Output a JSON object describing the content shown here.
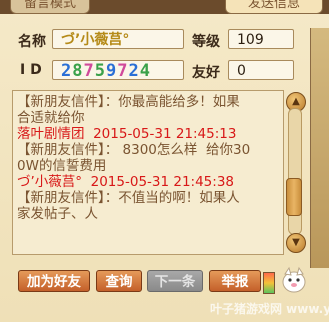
{
  "tabs": {
    "left": "留言模式",
    "right": "发送信息"
  },
  "info": {
    "name_label": "名称",
    "name_value": "づ’小薇莒°",
    "level_label": "等级",
    "level_value": "109",
    "id_label": "I D",
    "id_value": [
      "2",
      "8",
      "7",
      "5",
      "9",
      "7",
      "2",
      "4"
    ],
    "friend_label": "友好",
    "friend_value": "0"
  },
  "messages": [
    {
      "type": "sys",
      "text": "【新朋友信件】：你最高能给多！如果"
    },
    {
      "type": "sys",
      "text": "合适就给你"
    },
    {
      "type": "red",
      "text": "落叶剧情团  2015-05-31 21:45:13"
    },
    {
      "type": "sys",
      "text": "【新朋友信件】： 8300怎么样  给你30"
    },
    {
      "type": "sys",
      "text": "0W的信誓费用"
    },
    {
      "type": "red",
      "text": "づ’小薇莒°  2015-05-31 21:45:38"
    },
    {
      "type": "sys",
      "text": "【新朋友信件】：不值当的啊！如果人"
    },
    {
      "type": "sys",
      "text": "家发帖子、人"
    }
  ],
  "buttons": {
    "add_friend": "加为好友",
    "query": "查询",
    "next": "下一条",
    "report": "举报"
  },
  "watermark": "叶子猪游戏网 www.yzz.cn",
  "colors": {
    "accent": "#c4602a",
    "system_text": "#7a5431",
    "highlight": "#d81818"
  }
}
